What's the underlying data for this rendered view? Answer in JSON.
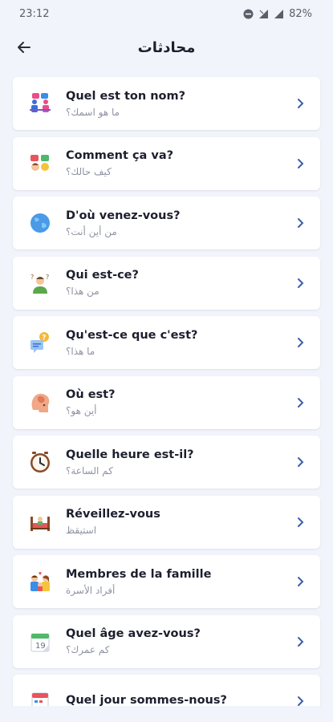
{
  "status_bar": {
    "time": "23:12",
    "battery": "82%"
  },
  "app_bar": {
    "title": "محادثات"
  },
  "items": [
    {
      "title": "Quel est ton nom?",
      "subtitle": "ما هو اسمك؟",
      "icon": "people-talking-icon"
    },
    {
      "title": "Comment ça va?",
      "subtitle": "كيف حالك؟",
      "icon": "faces-chat-icon"
    },
    {
      "title": "D'où venez-vous?",
      "subtitle": "من أين أنت؟",
      "icon": "globe-icon"
    },
    {
      "title": "Qui est-ce?",
      "subtitle": "من هذا؟",
      "icon": "person-question-icon"
    },
    {
      "title": "Qu'est-ce que c'est?",
      "subtitle": "ما هذا؟",
      "icon": "speech-question-icon"
    },
    {
      "title": "Où est?",
      "subtitle": "أين هو؟",
      "icon": "head-thinking-icon"
    },
    {
      "title": "Quelle heure est-il?",
      "subtitle": "كم الساعة؟",
      "icon": "clock-icon"
    },
    {
      "title": "Réveillez-vous",
      "subtitle": "استيقظ",
      "icon": "bed-wakeup-icon"
    },
    {
      "title": "Membres de la famille",
      "subtitle": "أفراد الأسرة",
      "icon": "family-icon"
    },
    {
      "title": "Quel âge avez-vous?",
      "subtitle": "كم عمرك؟",
      "icon": "calendar-age-icon"
    },
    {
      "title": "Quel jour sommes-nous?",
      "subtitle": "",
      "icon": "calendar-day-icon"
    }
  ]
}
